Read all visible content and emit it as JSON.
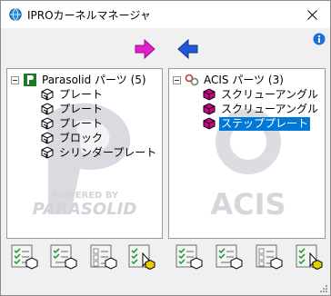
{
  "window": {
    "title": "IPROカーネルマネージャ",
    "icons": {
      "app": "globe-icon",
      "close": "close-icon",
      "info": "info-icon",
      "grip": "resize-grip-icon"
    }
  },
  "toolbar": {
    "transfer_right_icon": "arrow-right-icon",
    "transfer_left_icon": "arrow-left-icon",
    "colors": {
      "right_arrow": "#e020c8",
      "left_arrow": "#2050d0"
    }
  },
  "parasolid": {
    "root_label": "Parasolid パーツ (5)",
    "watermark": "PARASOLID",
    "watermark_sub": "POWERED BY",
    "items": [
      {
        "label": "プレート"
      },
      {
        "label": "プレート"
      },
      {
        "label": "プレート"
      },
      {
        "label": "ブロック"
      },
      {
        "label": "シリンダープレート"
      }
    ]
  },
  "acis": {
    "root_label": "ACIS パーツ (3)",
    "watermark": "ACIS",
    "items": [
      {
        "label": "スクリューアングル",
        "selected": false
      },
      {
        "label": "スクリューアングル",
        "selected": false
      },
      {
        "label": "ステッププレート",
        "selected": true
      }
    ]
  },
  "bottom_tools": {
    "left": [
      "check-list-icon",
      "check-list-icon",
      "list-icon",
      "check-list-cursor-icon"
    ],
    "right": [
      "check-list-icon",
      "check-list-icon",
      "list-icon",
      "check-list-cursor-icon"
    ]
  },
  "colors": {
    "selection": "#0078d7",
    "part_icon": "#d4008c"
  }
}
